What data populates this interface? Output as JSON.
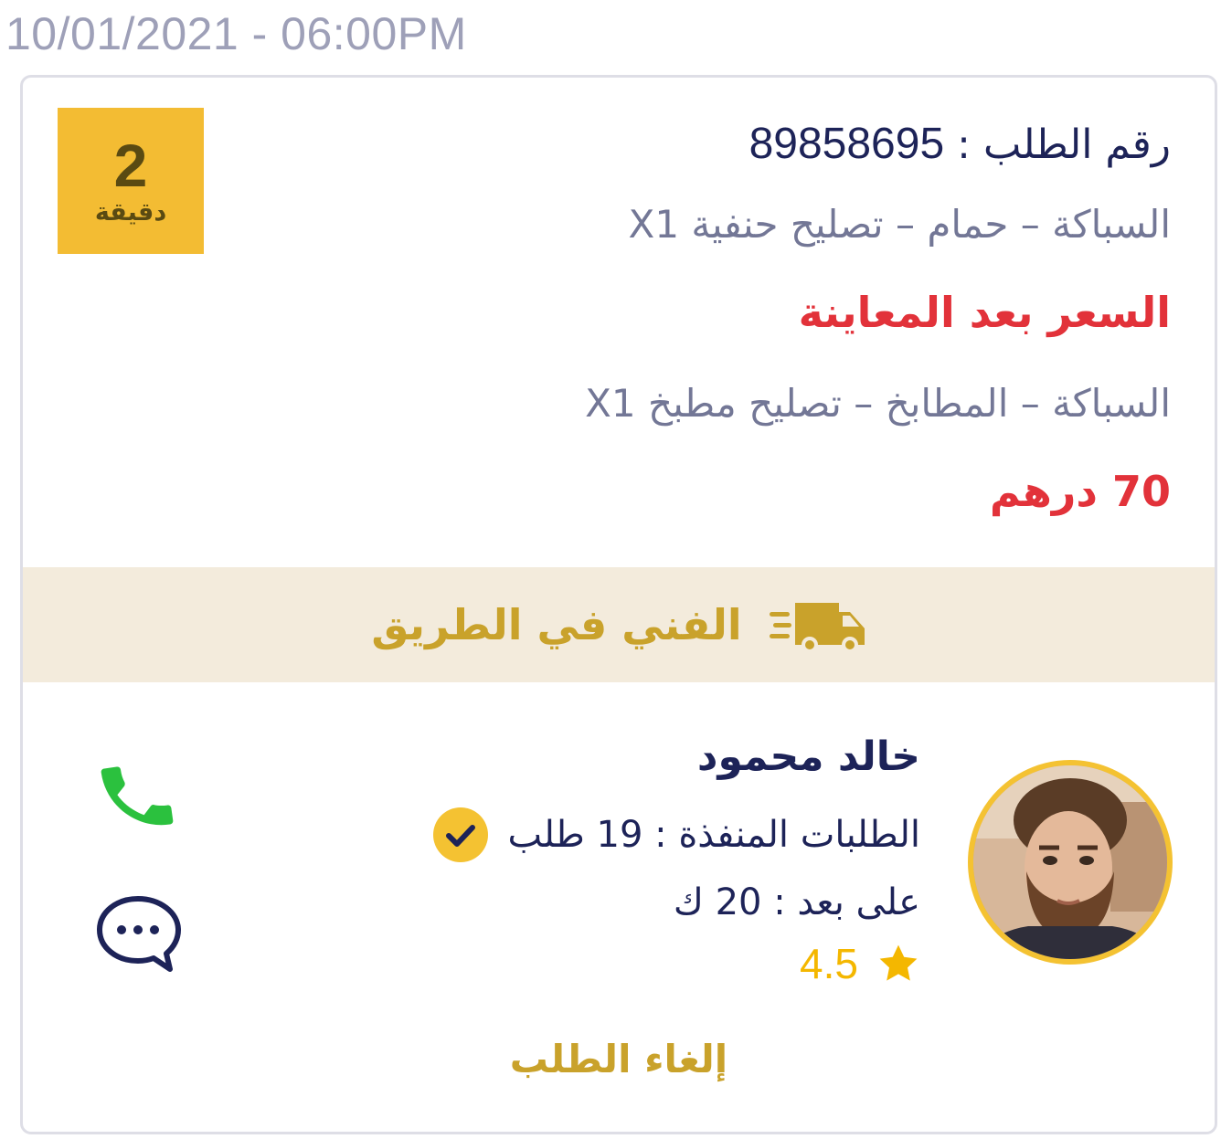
{
  "timestamp": "10/01/2021 - 06:00PM",
  "timer": {
    "value": "2",
    "unit": "دقيقة"
  },
  "order": {
    "number_label": "رقم الطلب :",
    "number_value": "89858695",
    "items": [
      {
        "service": "السباكة – حمام – تصليح حنفية X1",
        "price": "السعر بعد المعاينة"
      },
      {
        "service": "السباكة – المطابخ – تصليح مطبخ X1",
        "price": "70 درهم"
      }
    ]
  },
  "status": {
    "label": "الفني في الطريق",
    "icon": "delivery-truck-icon",
    "color": "#c9a22b"
  },
  "technician": {
    "name": "خالد محمود",
    "completed_orders": "الطلبات المنفذة : 19 طلب",
    "distance": "على بعد : 20 ك",
    "rating": "4.5",
    "verified_icon": "check-badge-icon",
    "avatar_icon": "technician-avatar"
  },
  "actions": {
    "call_icon": "phone-icon",
    "chat_icon": "chat-bubble-icon",
    "cancel_label": "إلغاء الطلب"
  },
  "colors": {
    "accent_yellow": "#f3bc33",
    "navy": "#1d2358",
    "red": "#e2323a",
    "green": "#2bc13e",
    "banner_bg": "#f3ebdc"
  }
}
